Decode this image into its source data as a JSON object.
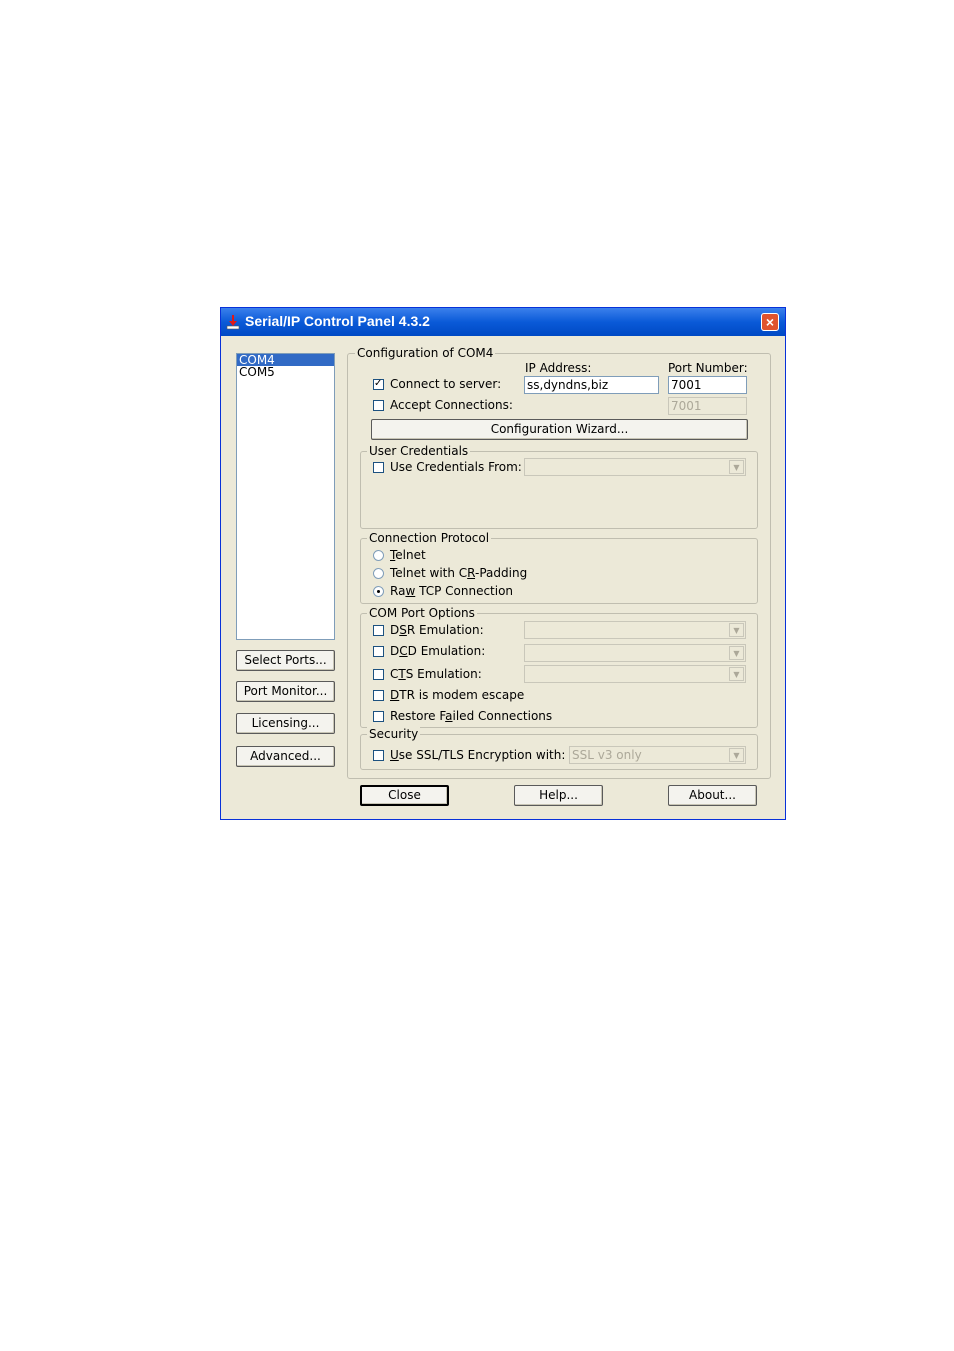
{
  "window": {
    "title": "Serial/IP Control Panel 4.3.2",
    "close_glyph": "×"
  },
  "ports": {
    "items": [
      {
        "label": "COM4",
        "selected": true
      },
      {
        "label": "COM5",
        "selected": false
      }
    ]
  },
  "left_buttons": {
    "select_ports": "Select Ports...",
    "port_monitor": "Port Monitor...",
    "licensing": "Licensing...",
    "advanced": "Advanced..."
  },
  "config": {
    "group_label": "Configuration of COM4",
    "ip_label": "IP Address:",
    "port_label": "Port Number:",
    "connect_label": "Connect to server:",
    "connect_checked": true,
    "ip_value": "ss,dyndns,biz",
    "port_value": "7001",
    "accept_label": "Accept Connections:",
    "accept_checked": false,
    "accept_port_value": "7001",
    "wizard_button": "Configuration Wizard..."
  },
  "credentials": {
    "group_label": "User Credentials",
    "use_label": "Use Credentials From:",
    "use_checked": false,
    "value": ""
  },
  "protocol": {
    "group_label": "Connection Protocol",
    "telnet": {
      "pre": "",
      "u": "T",
      "post": "elnet"
    },
    "telnet_cr": {
      "pre": "Telnet with C",
      "u": "R",
      "post": "-Padding"
    },
    "raw_tcp": {
      "pre": "Ra",
      "u": "w",
      "post": " TCP Connection"
    },
    "selected": "raw_tcp"
  },
  "com_options": {
    "group_label": "COM Port Options",
    "dsr": {
      "pre": "D",
      "u": "S",
      "post": "R Emulation:"
    },
    "dcd": {
      "pre": "D",
      "u": "C",
      "post": "D Emulation:"
    },
    "cts": {
      "pre": "C",
      "u": "T",
      "post": "S Emulation:"
    },
    "dtr": {
      "pre": "",
      "u": "D",
      "post": "TR is modem escape"
    },
    "restore": {
      "pre": "Restore F",
      "u": "a",
      "post": "iled Connections"
    }
  },
  "security": {
    "group_label": "Security",
    "ssl": {
      "pre": "",
      "u": "U",
      "post": "se SSL/TLS Encryption with:"
    },
    "ssl_value": "SSL v3 only"
  },
  "bottom_buttons": {
    "close": "Close",
    "help": "Help...",
    "about": "About..."
  },
  "icons": {
    "app": "serial-ip-app-icon",
    "combo_arrow": "▼"
  },
  "colors": {
    "titlebar": "#0a5ad8",
    "selection": "#316ac5",
    "face": "#ece9d8"
  }
}
